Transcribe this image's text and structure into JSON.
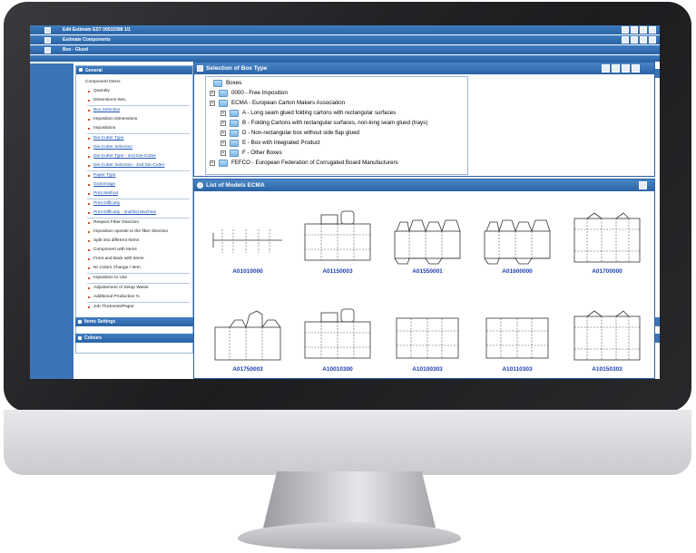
{
  "header": {
    "row1": "Edit Estimate  EST  00010398  1/1",
    "row2": "Estimate Components",
    "row3": "Box - Glued"
  },
  "general_panel": {
    "title": "General",
    "items": [
      "Component Descr.",
      "Quantity",
      "Dimensions WxL",
      "Box Selection",
      "Imposition Dimensions",
      "Impositions",
      "Die-Cutter Type",
      "Die-Cutter Selection",
      "Die-Cutter Type - 2nd Die-Cutter",
      "Die-Cutter Selection - 2nd Die-Cutter",
      "Paper Type",
      "Grammage",
      "Print Method",
      "Print Difficulty",
      "Print Difficulty - 2nd/3rd Machine",
      "Respect Fiber Direction",
      "Imposition oposite to the fiber direction",
      "Split into different Items",
      "Component with Items",
      "Front and Back with Items",
      "Nr Colors Change / Item",
      "Imposition to Use",
      "Adjustement of Setup Waste",
      "Additional Production %",
      "Job Thickness/Paper"
    ]
  },
  "items_settings": {
    "title": "Items Settings"
  },
  "colours": {
    "title": "Colours"
  },
  "selection_window": {
    "title": "Selection of Box Type",
    "tree": {
      "root": "Boxes",
      "nodes": [
        "0000 - Free Imposition",
        "ECMA - European Carton Makers Association",
        "A - Long seam glued folding cartons with rectangular surfaces",
        "B - Folding Cartons with rectangular surfaces, non-long seam glued (trays)",
        "D - Non-rectangular box without side flap glued",
        "E - Box with Integrated Product",
        "F - Other Boxes",
        "FEFCO - European Federation of Corrugated Board Manufacturers"
      ]
    }
  },
  "models_window": {
    "title": "List of Models ECMA",
    "models": [
      "A01010000",
      "A01150003",
      "A01550001",
      "A01600000",
      "A01700000",
      "A01750003",
      "A10010300",
      "A10100303",
      "A10110303",
      "A10150303"
    ]
  }
}
